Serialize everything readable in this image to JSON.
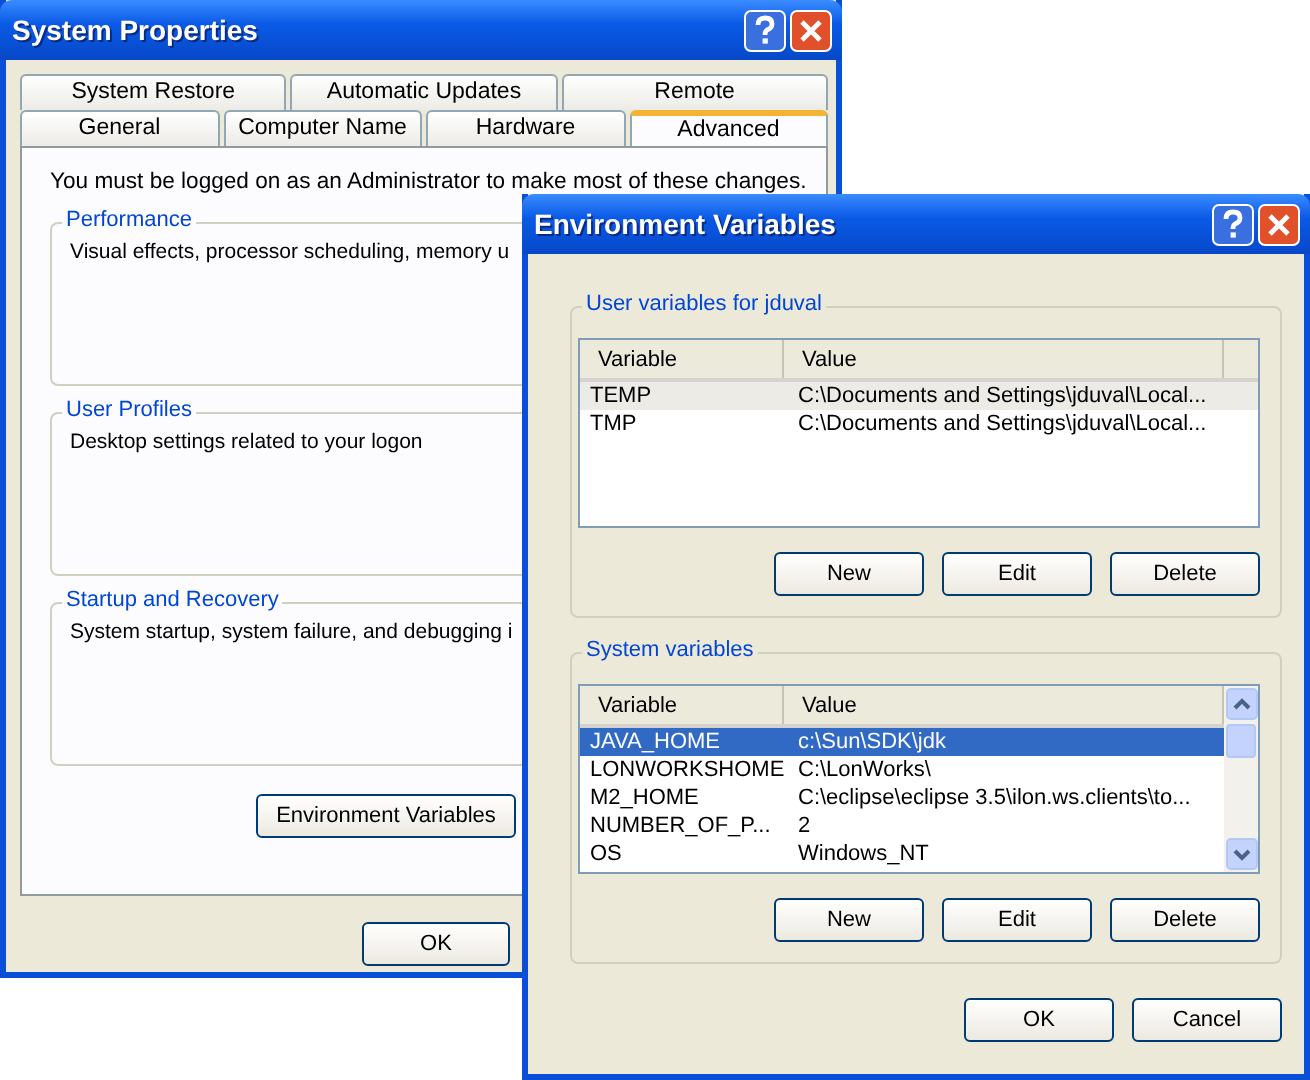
{
  "system_properties": {
    "title": "System Properties",
    "tab_rows": [
      [
        {
          "label": "System Restore",
          "selected": false
        },
        {
          "label": "Automatic Updates",
          "selected": false
        },
        {
          "label": "Remote",
          "selected": false
        }
      ],
      [
        {
          "label": "General",
          "selected": false
        },
        {
          "label": "Computer Name",
          "selected": false
        },
        {
          "label": "Hardware",
          "selected": false
        },
        {
          "label": "Advanced",
          "selected": true
        }
      ]
    ],
    "notice": "You must be logged on as an Administrator to make most of these changes.",
    "groups": [
      {
        "title": "Performance",
        "description": "Visual effects, processor scheduling, memory u"
      },
      {
        "title": "User Profiles",
        "description": "Desktop settings related to your logon"
      },
      {
        "title": "Startup and Recovery",
        "description": "System startup, system failure, and debugging i"
      }
    ],
    "environment_button": "Environment Variables",
    "ok_button": "OK"
  },
  "environment_variables": {
    "title": "Environment Variables",
    "sections": [
      {
        "title": "User variables for jduval",
        "active": false,
        "scrollbar": false,
        "columns": [
          "Variable",
          "Value"
        ],
        "rows": [
          {
            "variable": "TEMP",
            "value": "C:\\Documents and Settings\\jduval\\Local...",
            "selected": true
          },
          {
            "variable": "TMP",
            "value": "C:\\Documents and Settings\\jduval\\Local...",
            "selected": false
          }
        ],
        "buttons": [
          "New",
          "Edit",
          "Delete"
        ]
      },
      {
        "title": "System variables",
        "active": true,
        "scrollbar": true,
        "columns": [
          "Variable",
          "Value"
        ],
        "rows": [
          {
            "variable": "JAVA_HOME",
            "value": "c:\\Sun\\SDK\\jdk",
            "selected": true
          },
          {
            "variable": "LONWORKSHOME",
            "value": "C:\\LonWorks\\",
            "selected": false
          },
          {
            "variable": "M2_HOME",
            "value": "C:\\eclipse\\eclipse 3.5\\ilon.ws.clients\\to...",
            "selected": false
          },
          {
            "variable": "NUMBER_OF_P...",
            "value": "2",
            "selected": false
          },
          {
            "variable": "OS",
            "value": "Windows_NT",
            "selected": false
          }
        ],
        "buttons": [
          "New",
          "Edit",
          "Delete"
        ]
      }
    ],
    "ok_button": "OK",
    "cancel_button": "Cancel"
  }
}
